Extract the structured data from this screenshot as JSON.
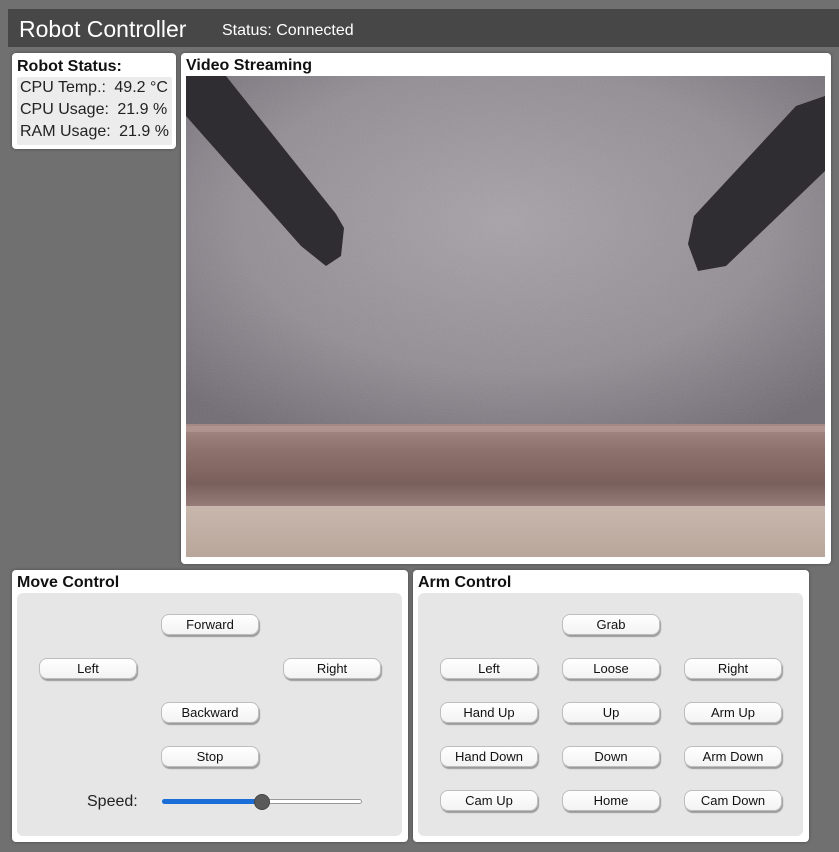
{
  "header": {
    "title": "Robot Controller",
    "status": "Status: Connected"
  },
  "robot_status": {
    "title": "Robot Status:",
    "rows": [
      {
        "label": "CPU Temp.:",
        "value": "49.2 °C"
      },
      {
        "label": "CPU Usage:",
        "value": "21.9 %"
      },
      {
        "label": "RAM Usage:",
        "value": "21.9 %"
      }
    ]
  },
  "video": {
    "title": "Video Streaming"
  },
  "move_control": {
    "title": "Move Control",
    "forward": "Forward",
    "left": "Left",
    "right": "Right",
    "backward": "Backward",
    "stop": "Stop",
    "speed_label": "Speed:",
    "speed_fraction": 0.5
  },
  "arm_control": {
    "title": "Arm Control",
    "grab": "Grab",
    "left": "Left",
    "loose": "Loose",
    "right": "Right",
    "hand_up": "Hand Up",
    "up": "Up",
    "arm_up": "Arm Up",
    "hand_down": "Hand Down",
    "down": "Down",
    "arm_down": "Arm Down",
    "cam_up": "Cam Up",
    "home": "Home",
    "cam_down": "Cam Down"
  },
  "colors": {
    "header_bg": "#474747",
    "page_bg": "#707070",
    "slider_fill": "#1a6ed8"
  }
}
